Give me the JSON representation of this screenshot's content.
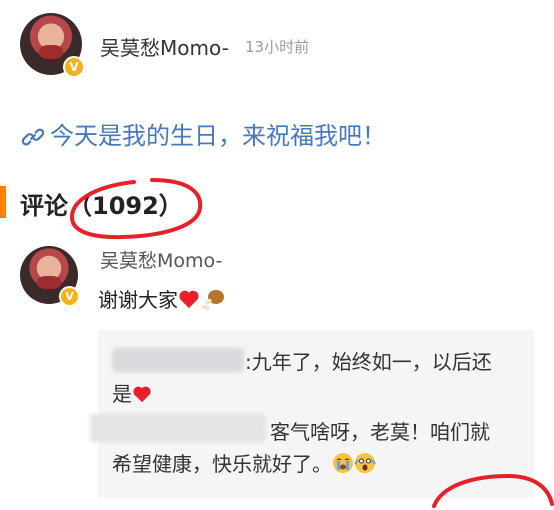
{
  "post": {
    "author": "吴莫愁Momo-",
    "time": "13小时前",
    "text": "今天是我的生日，来祝福我吧！",
    "verified_badge": "V"
  },
  "comments": {
    "label": "评论（1092）",
    "accent_color": "#ff8200"
  },
  "comment": {
    "author": "吴莫愁Momo-",
    "text": "谢谢大家"
  },
  "replies": [
    {
      "text1": ":九年了，始终如一，以后还",
      "text2": "是"
    },
    {
      "text1": "客气啥呀，老莫！咱们就",
      "text2": "希望健康，快乐就好了。"
    }
  ],
  "colors": {
    "link_text": "#4779b8",
    "annotation_red": "#e8202a",
    "verified": "#f3b21a"
  }
}
